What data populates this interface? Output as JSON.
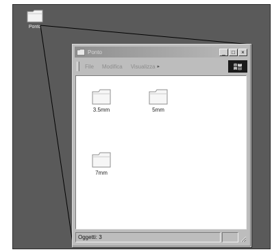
{
  "desktop": {
    "icon_label": "Ponto",
    "icon_name": "folder-icon"
  },
  "window": {
    "title": "Ponto",
    "buttons": {
      "minimize": "_",
      "maximize": "□",
      "close": "×"
    },
    "menu": {
      "items": [
        "File",
        "Modifica",
        "Visualizza"
      ],
      "logo_icon": "windows-logo-icon"
    },
    "folders": [
      {
        "label": "3.5mm"
      },
      {
        "label": "5mm"
      },
      {
        "label": "7mm"
      }
    ],
    "status": {
      "text": "Oggetti: 3"
    }
  },
  "colors": {
    "desktop": "#5a5a5a",
    "window_chrome": "#bdbdbd",
    "content_bg": "#ffffff"
  }
}
